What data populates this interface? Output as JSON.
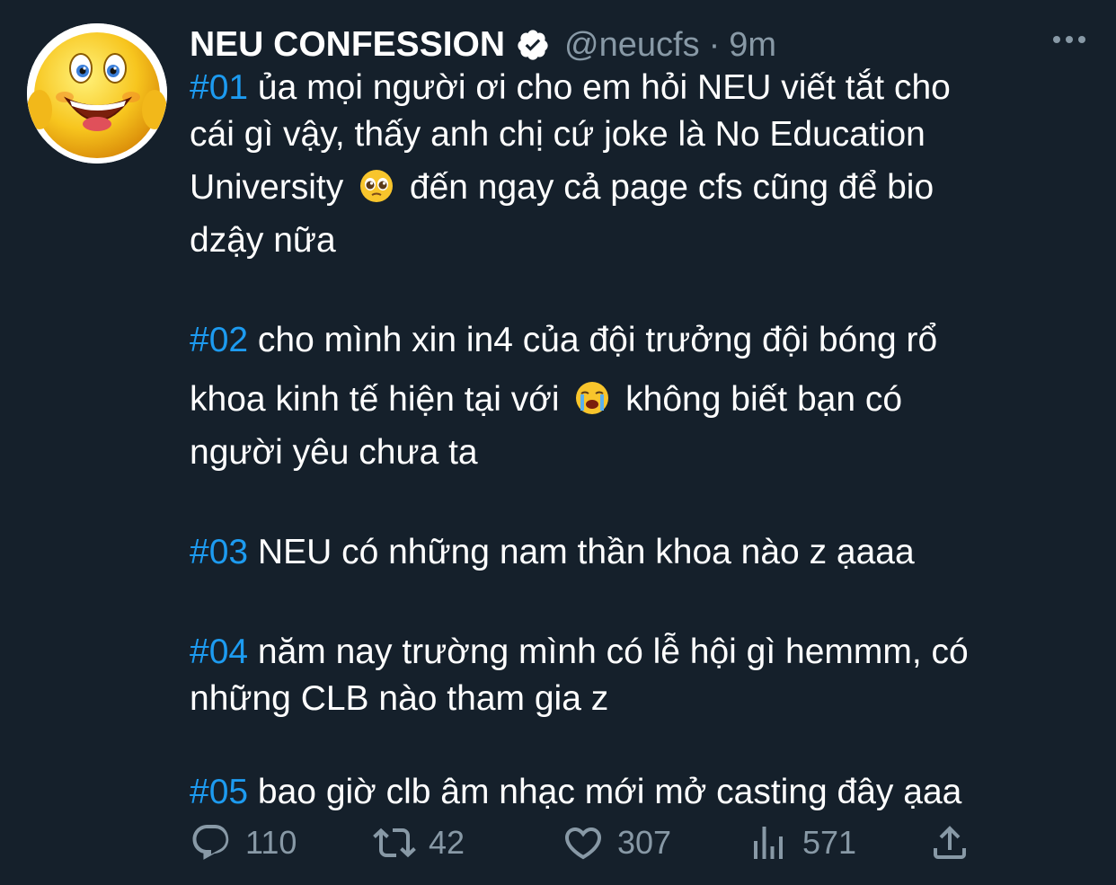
{
  "tweet": {
    "author_name": "NEU CONFESSION",
    "handle": "@neucfs",
    "separator": "·",
    "time": "9m",
    "verified": true,
    "posts": [
      {
        "tag": "#01",
        "line1": " ủa mọi người ơi cho em hỏi NEU viết tắt cho",
        "line2": "cái gì vậy, thấy anh chị cứ joke là No Education",
        "line3a": "University ",
        "line3_emoji": "pleading-face-emoji",
        "line3b": " đến ngay cả page cfs cũng để bio",
        "line4": "dzậy nữa"
      },
      {
        "tag": "#02",
        "line1": " cho mình xin in4 của đội trưởng đội bóng rổ",
        "line2a": "khoa kinh tế hiện tại với ",
        "line2_emoji": "loudly-crying-face-emoji",
        "line2b": " không biết bạn có",
        "line3": "người yêu chưa ta"
      },
      {
        "tag": "#03",
        "line1": " NEU có những nam thần khoa nào z ạaaa"
      },
      {
        "tag": "#04",
        "line1": " năm nay trường mình có lễ hội gì hemmm, có",
        "line2": "những CLB nào tham gia z"
      },
      {
        "tag": "#05",
        "line1": " bao giờ clb âm nhạc mới mở casting đây ạaa"
      }
    ],
    "actions": {
      "reply": {
        "icon": "reply-icon",
        "count": "110"
      },
      "retweet": {
        "icon": "retweet-icon",
        "count": "42"
      },
      "like": {
        "icon": "heart-icon",
        "count": "307"
      },
      "views": {
        "icon": "analytics-icon",
        "count": "571"
      },
      "share": {
        "icon": "share-icon"
      }
    }
  },
  "colors": {
    "background": "#15202b",
    "text": "#ffffff",
    "secondary": "#8899a6",
    "hashtag": "#1d9bf0"
  }
}
